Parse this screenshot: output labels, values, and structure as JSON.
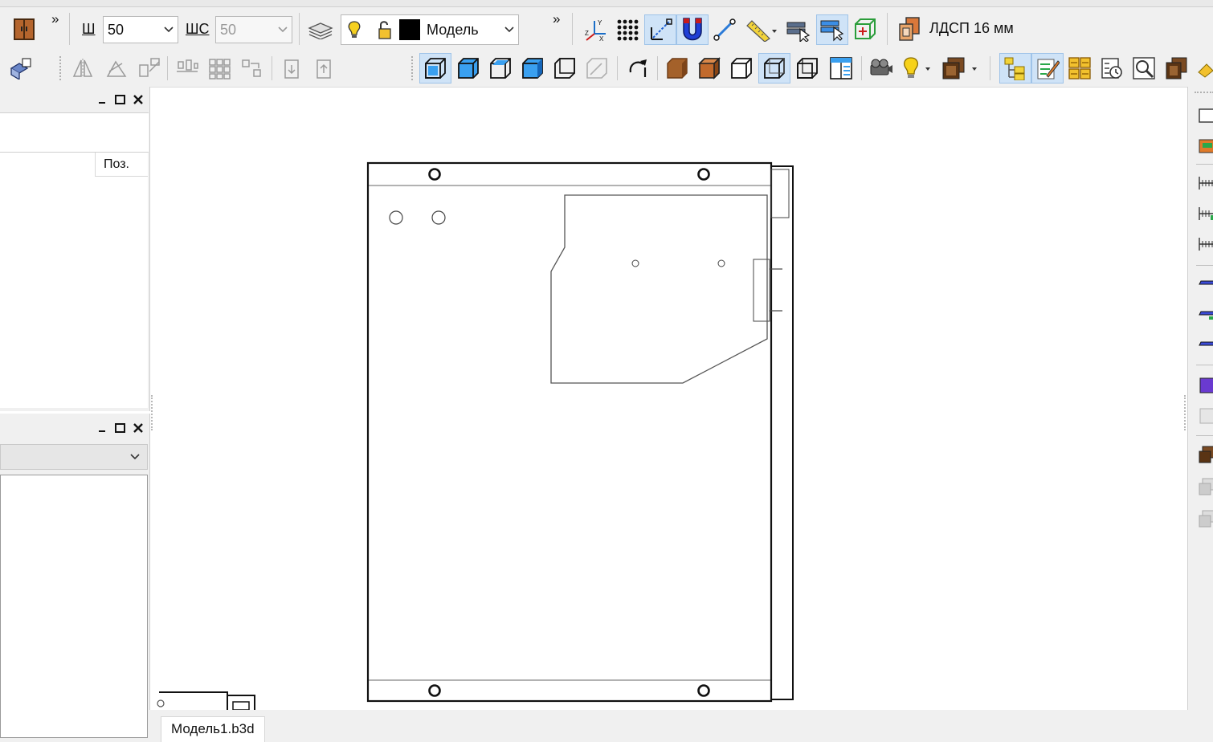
{
  "toolbar1": {
    "overflow_1": "»",
    "width_label": "Ш",
    "width_value": "50",
    "step_label": "ШС",
    "step_value": "50",
    "layer_value": "Модель",
    "overflow_2": "»",
    "material_label": "ЛДСП 16 мм"
  },
  "left_panel_1": {
    "column_header": "Поз."
  },
  "document_tab": {
    "label": "Модель1.b3d"
  },
  "colors": {
    "toolbar_bg": "#f0f0f0",
    "active_bg": "#cfe3f7",
    "accent_blue": "#1e90e6",
    "wood": "#b5652d",
    "magnet_blue": "#1f3fd6"
  }
}
